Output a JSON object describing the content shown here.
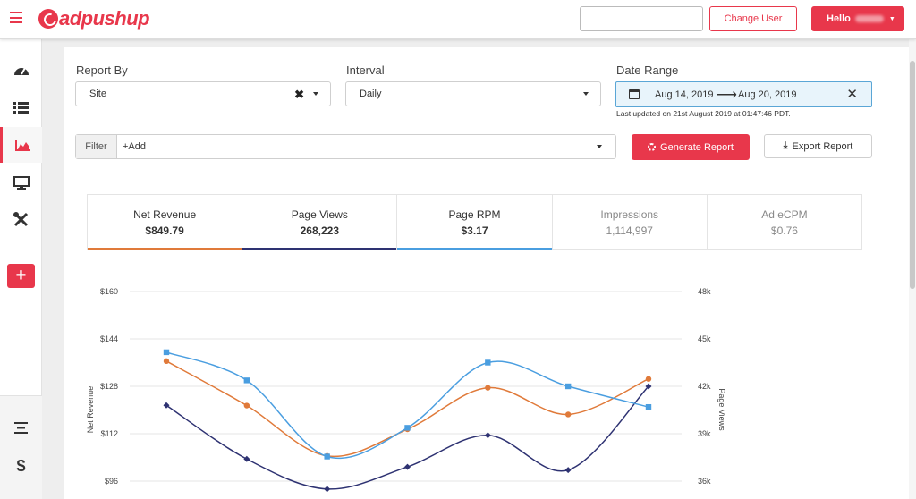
{
  "topbar": {
    "brand": "adpushup",
    "change_user_label": "Change User",
    "hello_label": "Hello",
    "search_value": ""
  },
  "sidebar": {
    "items": [
      {
        "icon": "dashboard-icon"
      },
      {
        "icon": "list-icon"
      },
      {
        "icon": "reports-chart-icon",
        "active": true
      },
      {
        "icon": "monitor-icon"
      },
      {
        "icon": "tools-icon"
      }
    ],
    "add_label": "+",
    "bottom_items": [
      {
        "icon": "align-center-icon"
      },
      {
        "icon": "dollar-icon",
        "label": "$"
      }
    ]
  },
  "filters": {
    "report_by_label": "Report By",
    "report_by_value": "Site",
    "interval_label": "Interval",
    "interval_value": "Daily",
    "date_range_label": "Date Range",
    "date_start": "Aug 14, 2019",
    "date_end": "Aug 20, 2019",
    "last_updated": "Last updated on 21st August 2019 at 01:47:46 PDT.",
    "filter_tag": "Filter",
    "filter_placeholder": "+Add",
    "generate_label": "Generate Report",
    "export_label": "Export Report"
  },
  "metrics": [
    {
      "title": "Net Revenue",
      "value": "$849.79",
      "color": "#e07a3a",
      "active": true
    },
    {
      "title": "Page Views",
      "value": "268,223",
      "color": "#2e3272",
      "active": true
    },
    {
      "title": "Page RPM",
      "value": "$3.17",
      "color": "#4a9ee0",
      "active": true
    },
    {
      "title": "Impressions",
      "value": "1,114,997",
      "active": false
    },
    {
      "title": "Ad eCPM",
      "value": "$0.76",
      "active": false
    }
  ],
  "chart_data": {
    "type": "line",
    "ylabel": "Net Revenue",
    "y2label": "Page Views",
    "ylim": [
      96,
      160
    ],
    "y_ticks": [
      "$96",
      "$112",
      "$128",
      "$144",
      "$160"
    ],
    "y2lim": [
      36000,
      48000
    ],
    "y2_ticks": [
      "36k",
      "39k",
      "42k",
      "45k",
      "48k"
    ],
    "grid": true,
    "series": [
      {
        "name": "Net Revenue",
        "color": "#e07a3a",
        "marker": "circle",
        "axis": "left",
        "values": [
          136.5,
          121.5,
          104.5,
          113.5,
          127.5,
          118.5,
          130.5
        ]
      },
      {
        "name": "Page Views",
        "color": "#2e3272",
        "marker": "diamond",
        "axis": "right",
        "values": [
          40.8,
          37.4,
          35.5,
          36.9,
          38.9,
          36.7,
          42.0
        ]
      },
      {
        "name": "Page RPM",
        "color": "#4a9ee0",
        "marker": "square",
        "axis": "left",
        "values": [
          139.5,
          130.0,
          104.3,
          114.0,
          136.0,
          128.0,
          121.0
        ]
      }
    ]
  }
}
